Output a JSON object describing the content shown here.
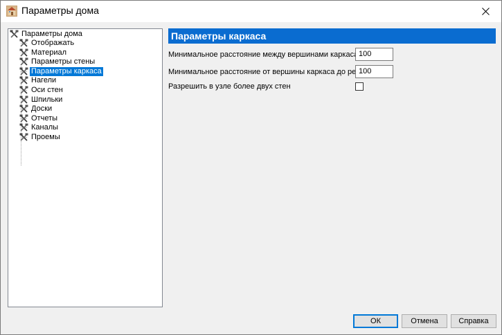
{
  "window": {
    "title": "Параметры дома"
  },
  "tree": {
    "root": "Параметры дома",
    "items": [
      {
        "label": "Отображать",
        "icon": "tools-icon"
      },
      {
        "label": "Материал",
        "icon": "tools-icon"
      },
      {
        "label": "Параметры стены",
        "icon": "tools-icon"
      },
      {
        "label": "Параметры каркаса",
        "icon": "tools-icon",
        "selected": true
      },
      {
        "label": "Нагели",
        "icon": "tools-icon"
      },
      {
        "label": "Оси стен",
        "icon": "tools-icon"
      },
      {
        "label": "Шпильки",
        "icon": "tools-icon"
      },
      {
        "label": "Доски",
        "icon": "tools-icon"
      },
      {
        "label": "Отчеты",
        "icon": "tools-icon"
      },
      {
        "label": "Каналы",
        "icon": "tools-icon"
      },
      {
        "label": "Проемы",
        "icon": "tools-icon"
      }
    ]
  },
  "panel": {
    "header": "Параметры каркаса",
    "params": [
      {
        "label": "Минимальное расстояние между вершинами каркаса:",
        "value": "100"
      },
      {
        "label": "Минимальное расстояние от вершины каркаса до ребра:",
        "value": "100"
      }
    ],
    "checkbox": {
      "label": "Разрешить в узле более двух стен",
      "checked": false
    }
  },
  "buttons": {
    "ok": "ОК",
    "cancel": "Отмена",
    "help": "Справка"
  },
  "colors": {
    "selection": "#0078d7",
    "header": "#0a6cd0"
  }
}
